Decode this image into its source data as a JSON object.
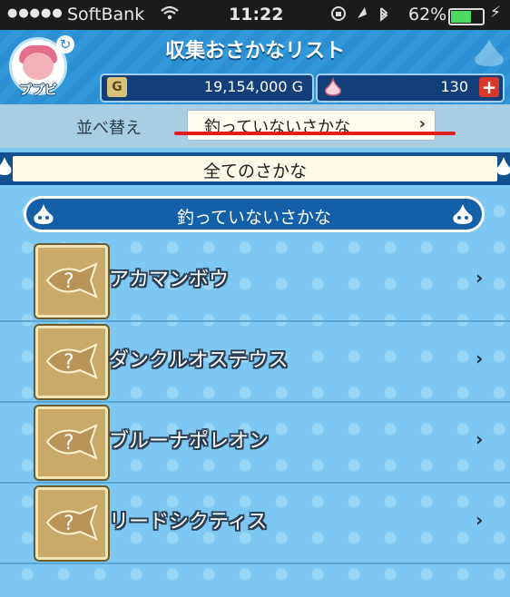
{
  "status_bar": {
    "signal_dots": "●●●●●",
    "carrier": "SoftBank",
    "time": "11:22",
    "battery_percent": "62%"
  },
  "header": {
    "title": "収集おさかなリスト",
    "username": "ププビ",
    "gold_icon_label": "G",
    "gold_amount": "19,154,000 G",
    "gem_amount": "130",
    "plus_label": "+"
  },
  "sort": {
    "label": "並べ替え",
    "selected": "釣っていないさかな",
    "chevron": "›"
  },
  "all_banner": {
    "label": "全てのさかな"
  },
  "category_banner": {
    "label": "釣っていないさかな"
  },
  "fish_list": [
    {
      "name": "アカマンボウ"
    },
    {
      "name": "ダンクルオステウス"
    },
    {
      "name": "ブルーナポレオン"
    },
    {
      "name": "リードシクティス"
    }
  ],
  "icons": {
    "unknown_fish": "?",
    "row_chevron": "›"
  },
  "colors": {
    "header_blue": "#2b8fd2",
    "list_bg": "#7cc8f2",
    "plus_red": "#d8392b",
    "underline_red": "#e31c1c"
  }
}
